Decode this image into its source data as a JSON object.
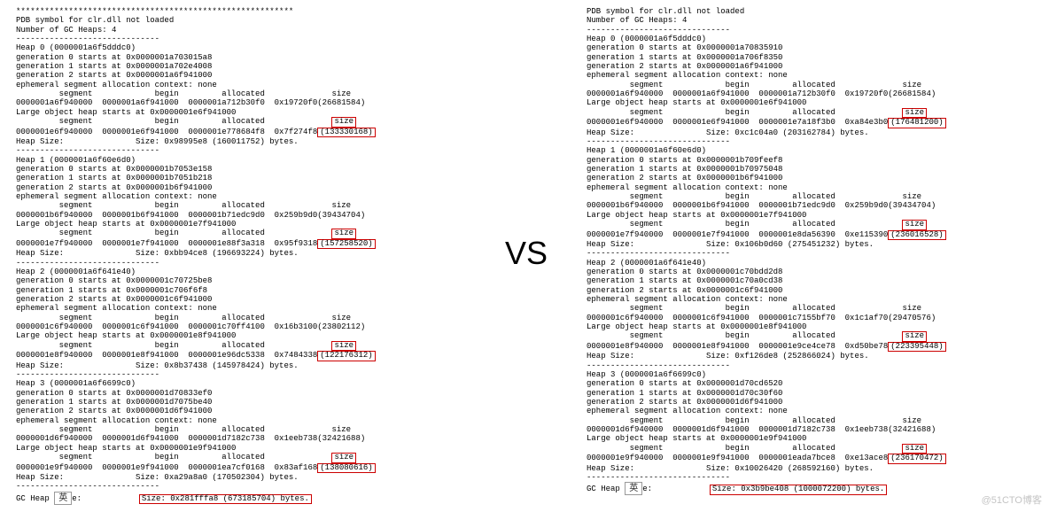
{
  "vs": "VS",
  "watermark": "@51CTO博客",
  "ime": "英",
  "left": {
    "stars": "**********************************************************",
    "pdb": "PDB symbol for clr.dll not loaded",
    "nheaps": "Number of GC Heaps: 4",
    "rule": "------------------------------",
    "heaps": [
      {
        "title": "Heap 0 (0000001a6f5dddc0)",
        "g0": "generation 0 starts at 0x0000001a703015a8",
        "g1": "generation 1 starts at 0x0000001a702e4008",
        "g2": "generation 2 starts at 0x0000001a6f941000",
        "eph": "ephemeral segment allocation context: none",
        "hdr": "         segment             begin         allocated              size",
        "row1": "0000001a6f940000  0000001a6f941000  0000001a712b30f0  0x19720f0(26681584)",
        "loh": "Large object heap starts at 0x0000001e6f941000",
        "hdr2": "         segment             begin         allocated              ",
        "row2_pre": "0000001e6f940000  0000001e6f941000  0000001e778684f8  0x7f274f8",
        "row2_hl": "(133330168)",
        "hsize": "Heap Size:               Size: 0x98995e8 (160011752) bytes."
      },
      {
        "title": "Heap 1 (0000001a6f60e6d0)",
        "g0": "generation 0 starts at 0x0000001b7053e158",
        "g1": "generation 1 starts at 0x0000001b7051b218",
        "g2": "generation 2 starts at 0x0000001b6f941000",
        "eph": "ephemeral segment allocation context: none",
        "hdr": "         segment             begin         allocated              size",
        "row1": "0000001b6f940000  0000001b6f941000  0000001b71edc9d0  0x259b9d0(39434704)",
        "loh": "Large object heap starts at 0x0000001e7f941000",
        "hdr2": "         segment             begin         allocated              ",
        "row2_pre": "0000001e7f940000  0000001e7f941000  0000001e88f3a318  0x95f9318",
        "row2_hl": "(157258520)",
        "hsize": "Heap Size:               Size: 0xbb94ce8 (196693224) bytes."
      },
      {
        "title": "Heap 2 (0000001a6f641e40)",
        "g0": "generation 0 starts at 0x0000001c70725be8",
        "g1": "generation 1 starts at 0x0000001c706f6f8",
        "g2": "generation 2 starts at 0x0000001c6f941000",
        "eph": "ephemeral segment allocation context: none",
        "hdr": "         segment             begin         allocated              size",
        "row1": "0000001c6f940000  0000001c6f941000  0000001c70ff4100  0x16b3100(23802112)",
        "loh": "Large object heap starts at 0x0000001e8f941000",
        "hdr2": "         segment             begin         allocated              ",
        "row2_pre": "0000001e8f940000  0000001e8f941000  0000001e96dc5338  0x7484338",
        "row2_hl": "(122176312)",
        "hsize": "Heap Size:               Size: 0x8b37438 (145978424) bytes."
      },
      {
        "title": "Heap 3 (0000001a6f6699c0)",
        "g0": "generation 0 starts at 0x0000001d70833ef0",
        "g1": "generation 1 starts at 0x0000001d7075be40",
        "g2": "generation 2 starts at 0x0000001d6f941000",
        "eph": "ephemeral segment allocation context: none",
        "hdr": "         segment             begin         allocated              size",
        "row1": "0000001d6f940000  0000001d6f941000  0000001d7182c738  0x1eeb738(32421688)",
        "loh": "Large object heap starts at 0x0000001e9f941000",
        "hdr2": "         segment             begin         allocated              ",
        "row2_pre": "0000001e9f940000  0000001e9f941000  0000001ea7cf0168  0x83af168",
        "row2_hl": "(138080616)",
        "hsize": "Heap Size:               Size: 0xa29a8a0 (170502304) bytes."
      }
    ],
    "gcheap_pre": "GC Heap ",
    "gcheap_post": "e:            ",
    "gcheap_hl": "Size: 0x281fffa8 (673185704) bytes."
  },
  "right": {
    "pdb": "PDB symbol for clr.dll not loaded",
    "nheaps": "Number of GC Heaps: 4",
    "rule": "------------------------------",
    "heaps": [
      {
        "title": "Heap 0 (0000001a6f5dddc0)",
        "g0": "generation 0 starts at 0x0000001a70835910",
        "g1": "generation 1 starts at 0x0000001a706f8350",
        "g2": "generation 2 starts at 0x0000001a6f941000",
        "eph": "ephemeral segment allocation context: none",
        "hdr": "         segment             begin         allocated              size",
        "row1": "0000001a6f940000  0000001a6f941000  0000001a712b30f0  0x19720f0(26681584)",
        "loh": "Large object heap starts at 0x0000001e6f941000",
        "hdr2": "         segment             begin         allocated              ",
        "row2_pre": "0000001e6f940000  0000001e6f941000  0000001e7a18f3b0  0xa84e3b0",
        "row2_hl": "(176481200)",
        "hsize": "Heap Size:               Size: 0xc1c04a0 (203162784) bytes."
      },
      {
        "title": "Heap 1 (0000001a6f60e6d0)",
        "g0": "generation 0 starts at 0x0000001b709feef8",
        "g1": "generation 1 starts at 0x0000001b70975048",
        "g2": "generation 2 starts at 0x0000001b6f941000",
        "eph": "ephemeral segment allocation context: none",
        "hdr": "         segment             begin         allocated              size",
        "row1": "0000001b6f940000  0000001b6f941000  0000001b71edc9d0  0x259b9d0(39434704)",
        "loh": "Large object heap starts at 0x0000001e7f941000",
        "hdr2": "         segment             begin         allocated              ",
        "row2_pre": "0000001e7f940000  0000001e7f941000  0000001e8da56390  0xe115390",
        "row2_hl": "(236016528)",
        "hsize": "Heap Size:               Size: 0x106b0d60 (275451232) bytes."
      },
      {
        "title": "Heap 2 (0000001a6f641e40)",
        "g0": "generation 0 starts at 0x0000001c70bdd2d8",
        "g1": "generation 1 starts at 0x0000001c70a0cd38",
        "g2": "generation 2 starts at 0x0000001c6f941000",
        "eph": "ephemeral segment allocation context: none",
        "hdr": "         segment             begin         allocated              size",
        "row1": "0000001c6f940000  0000001c6f941000  0000001c7155bf70  0x1c1af70(29470576)",
        "loh": "Large object heap starts at 0x0000001e8f941000",
        "hdr2": "         segment             begin         allocated              ",
        "row2_pre": "0000001e8f940000  0000001e8f941000  0000001e9ce4ce78  0xd50be78",
        "row2_hl": "(223395448)",
        "hsize": "Heap Size:               Size: 0xf126de8 (252866024) bytes."
      },
      {
        "title": "Heap 3 (0000001a6f6699c0)",
        "g0": "generation 0 starts at 0x0000001d70cd6520",
        "g1": "generation 1 starts at 0x0000001d70c30f60",
        "g2": "generation 2 starts at 0x0000001d6f941000",
        "eph": "ephemeral segment allocation context: none",
        "hdr": "         segment             begin         allocated              size",
        "row1": "0000001d6f940000  0000001d6f941000  0000001d7182c738  0x1eeb738(32421688)",
        "loh": "Large object heap starts at 0x0000001e9f941000",
        "hdr2": "         segment             begin         allocated              ",
        "row2_pre": "0000001e9f940000  0000001e9f941000  0000001eada7bce8  0xe13ace8",
        "row2_hl": "(236170472)",
        "hsize": "Heap Size:               Size: 0x10026420 (268592160) bytes."
      }
    ],
    "gcheap_pre": "GC Heap ",
    "gcheap_post": "e:            ",
    "gcheap_hl": "Size: 0x3b9be408 (1000072200) bytes."
  },
  "size_label": "size"
}
